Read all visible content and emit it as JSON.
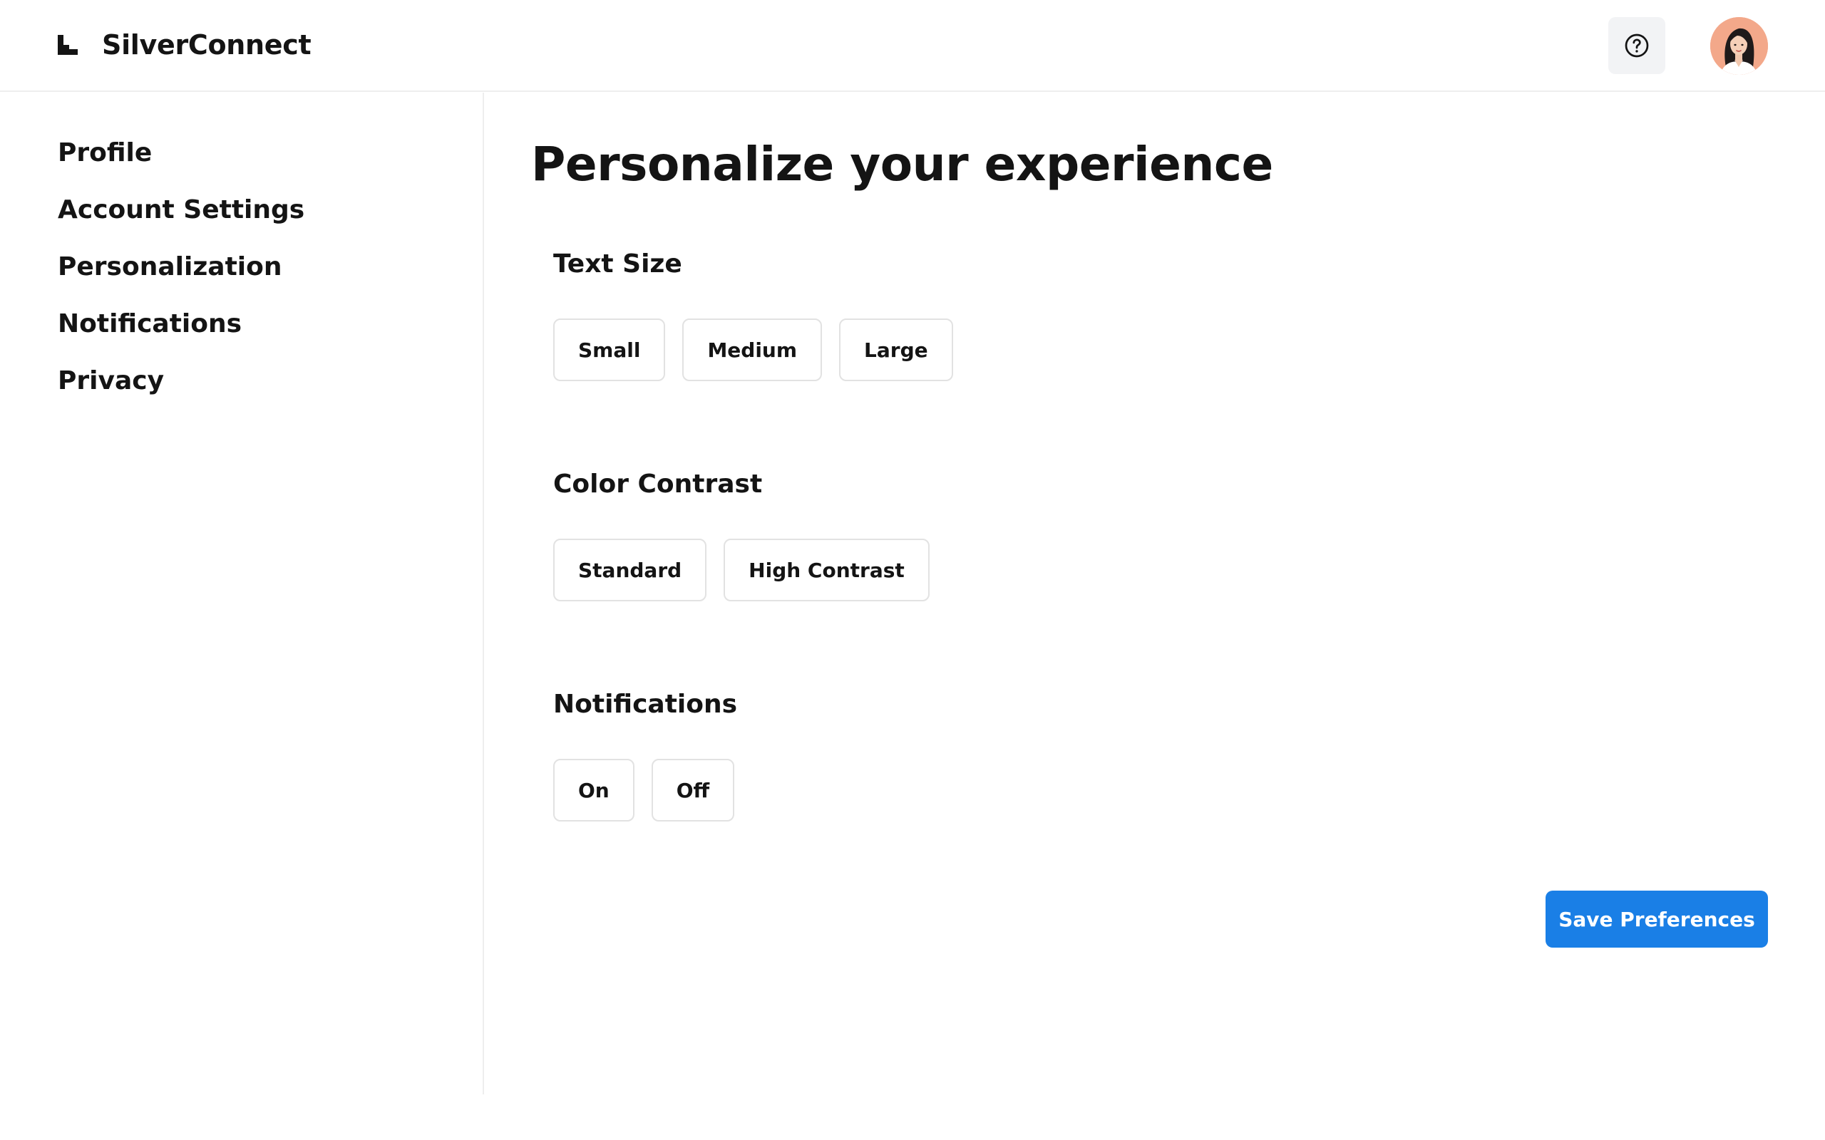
{
  "app": {
    "name": "SilverConnect",
    "logo_icon": "stair-logo-icon",
    "accent_color": "#1a7fe6"
  },
  "header": {
    "help_icon": "help-circle-icon",
    "avatar_icon": "user-avatar-portrait"
  },
  "sidebar": {
    "items": [
      {
        "label": "Profile"
      },
      {
        "label": "Account Settings"
      },
      {
        "label": "Personalization"
      },
      {
        "label": "Notifications"
      },
      {
        "label": "Privacy"
      }
    ]
  },
  "main": {
    "title": "Personalize your experience",
    "sections": [
      {
        "heading": "Text Size",
        "options": [
          "Small",
          "Medium",
          "Large"
        ]
      },
      {
        "heading": "Color Contrast",
        "options": [
          "Standard",
          "High Contrast"
        ]
      },
      {
        "heading": "Notifications",
        "options": [
          "On",
          "Off"
        ]
      }
    ],
    "save_label": "Save Preferences"
  }
}
